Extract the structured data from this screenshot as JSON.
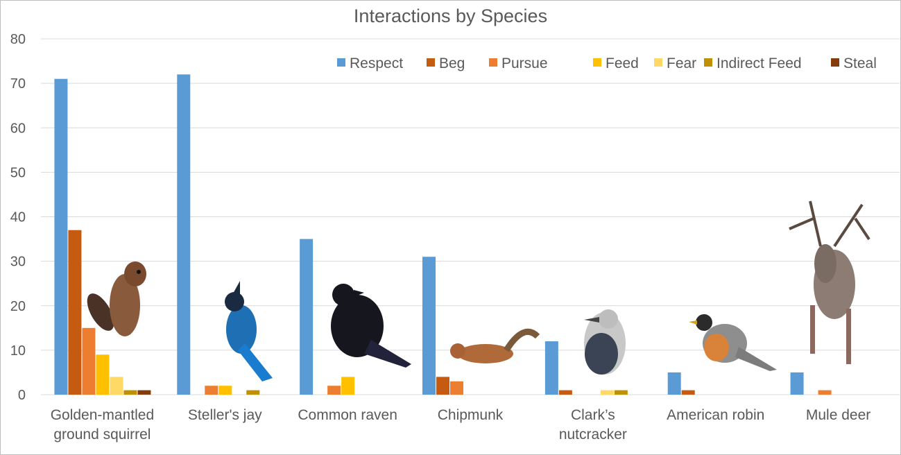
{
  "chart_data": {
    "type": "bar",
    "title": "Interactions by Species",
    "xlabel": "",
    "ylabel": "",
    "ylim": [
      0,
      80
    ],
    "yticks": [
      0,
      10,
      20,
      30,
      40,
      50,
      60,
      70,
      80
    ],
    "grid": true,
    "legend_position": "top-right",
    "categories": [
      [
        "Golden-mantled",
        "ground squirrel"
      ],
      [
        "Steller's jay"
      ],
      [
        "Common raven"
      ],
      [
        "Chipmunk"
      ],
      [
        "Clark’s",
        "nutcracker"
      ],
      [
        "American robin"
      ],
      [
        "Mule deer"
      ]
    ],
    "series": [
      {
        "name": "Respect",
        "color": "#5b9bd5",
        "values": [
          71,
          72,
          35,
          31,
          12,
          5,
          5
        ]
      },
      {
        "name": "Beg",
        "color": "#c55a11",
        "values": [
          37,
          0,
          0,
          4,
          1,
          1,
          0
        ]
      },
      {
        "name": "Pursue",
        "color": "#ed7d31",
        "values": [
          15,
          2,
          2,
          3,
          0,
          0,
          1
        ]
      },
      {
        "name": "Feed",
        "color": "#ffc000",
        "values": [
          9,
          2,
          4,
          0,
          0,
          0,
          0
        ]
      },
      {
        "name": "Fear",
        "color": "#ffd966",
        "values": [
          4,
          0,
          0,
          0,
          1,
          0,
          0
        ]
      },
      {
        "name": "Indirect Feed",
        "color": "#bf9000",
        "values": [
          1,
          1,
          0,
          0,
          1,
          0,
          0
        ]
      },
      {
        "name": "Steal",
        "color": "#843c0c",
        "values": [
          1,
          0,
          0,
          0,
          0,
          0,
          0
        ]
      }
    ],
    "images": [
      "squirrel",
      "jay",
      "raven",
      "chipmunk",
      "nutcracker",
      "robin",
      "deer"
    ]
  }
}
